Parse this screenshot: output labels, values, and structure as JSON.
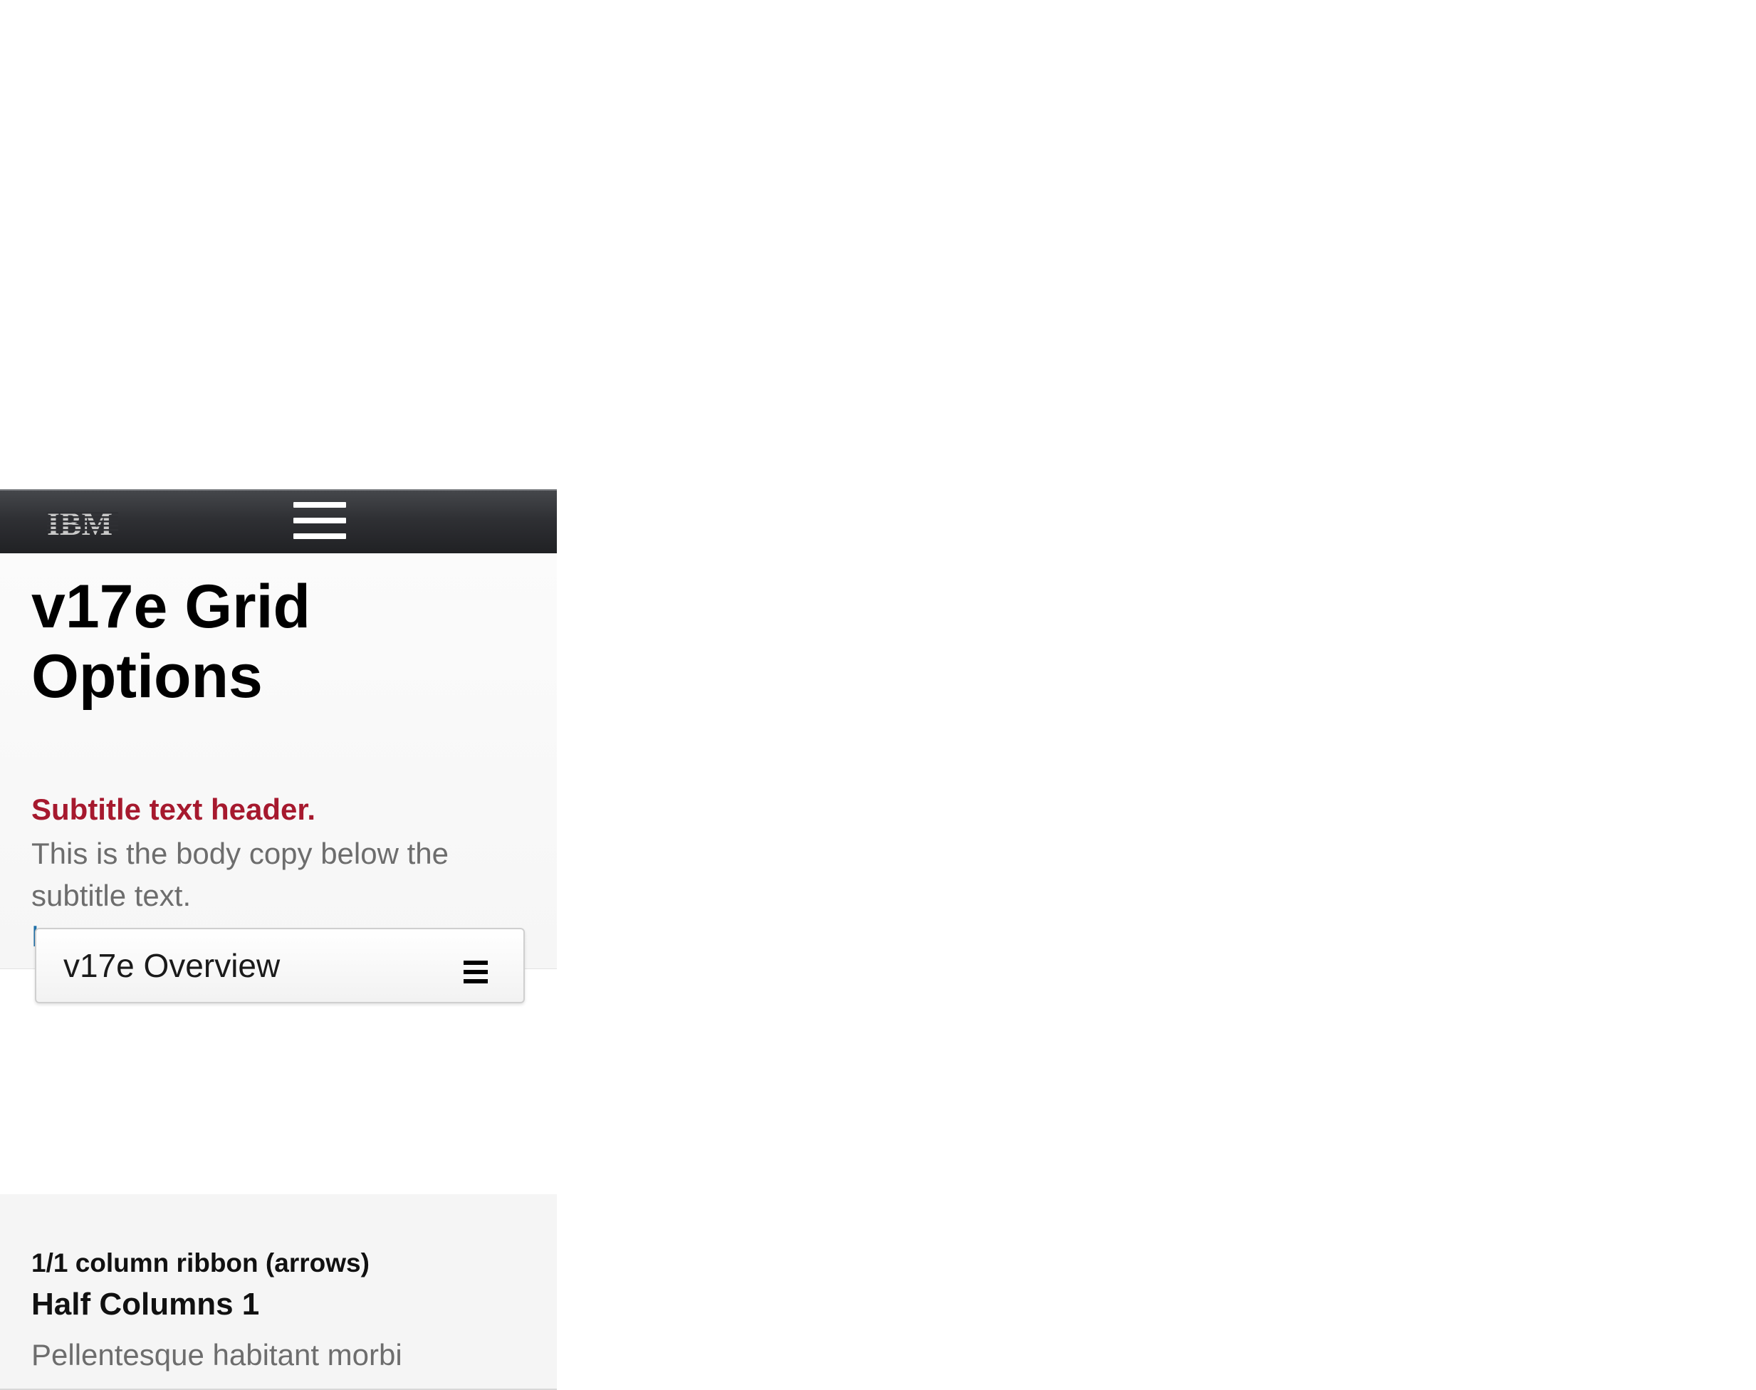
{
  "masthead": {
    "logo_text": "IBM",
    "menu_icon": "hamburger-menu-icon"
  },
  "leadspace": {
    "title": "v17e Grid Options",
    "subtitle": "Subtitle text header.",
    "body": "This is the body copy below the subtitle text.",
    "link": "Learn more"
  },
  "overview_select": {
    "selected": "v17e Overview",
    "icon": "menu-icon"
  },
  "ribbon": {
    "label": "1/1 column ribbon (arrows)",
    "heading": "Half Columns 1",
    "body": "Pellentesque habitant morbi"
  },
  "colors": {
    "accent_red": "#a6192e",
    "link_blue": "#1f70a8",
    "masthead_dark": "#2f3034"
  }
}
